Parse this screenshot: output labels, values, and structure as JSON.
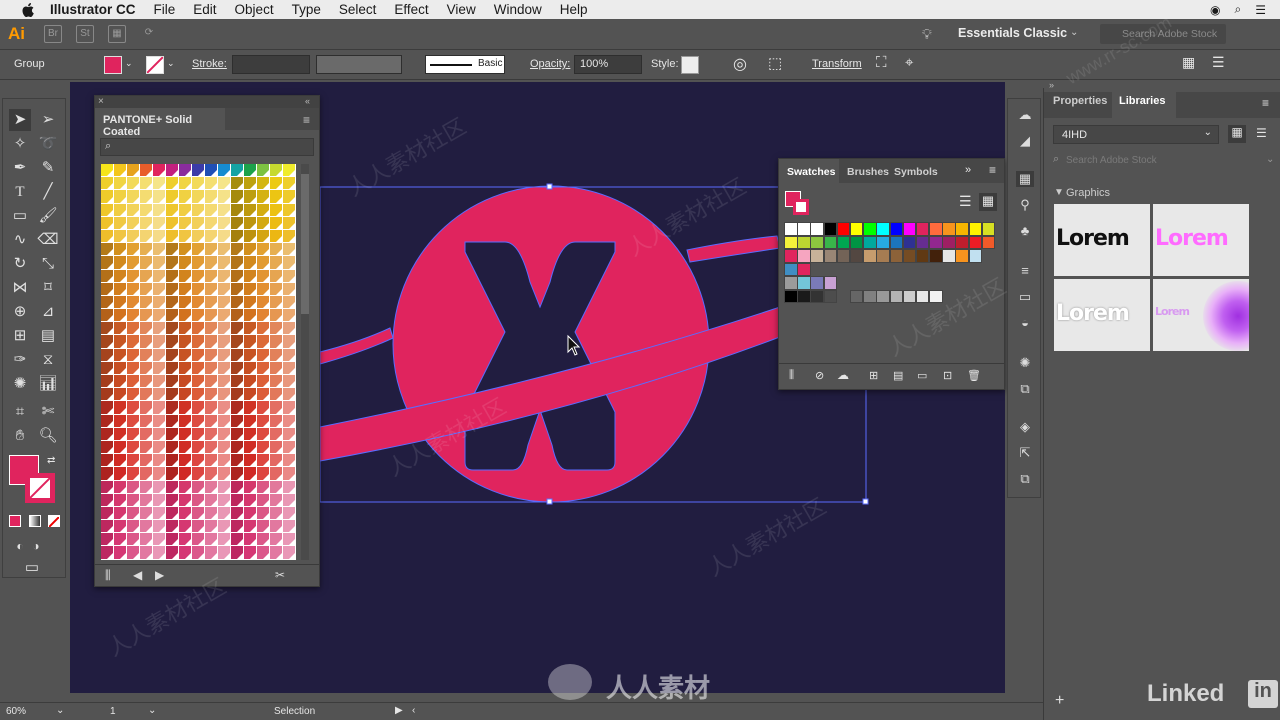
{
  "menubar": {
    "app_name": "Illustrator CC",
    "items": [
      "File",
      "Edit",
      "Object",
      "Type",
      "Select",
      "Effect",
      "View",
      "Window",
      "Help"
    ]
  },
  "appbar": {
    "logo": "Ai",
    "workspace": "Essentials Classic",
    "stock_search_placeholder": "Search Adobe Stock"
  },
  "controlbar": {
    "selection_type": "Group",
    "stroke_label": "Stroke:",
    "brush_basic": "Basic",
    "opacity_label": "Opacity:",
    "opacity_value": "100%",
    "style_label": "Style:",
    "transform_label": "Transform",
    "fill_color": "#e0245e"
  },
  "pantone_panel": {
    "title": "PANTONE+ Solid Coated"
  },
  "swatches_panel": {
    "tabs": [
      "Swatches",
      "Brushes",
      "Symbols"
    ]
  },
  "libraries_panel": {
    "tabs": [
      "Properties",
      "Libraries"
    ],
    "library_name": "4IHD",
    "search_placeholder": "Search Adobe Stock",
    "section": "Graphics",
    "thumbs": [
      "Lorem",
      "Lorem",
      "Lorem",
      "Lorem"
    ]
  },
  "statusbar": {
    "zoom": "60%",
    "artboard": "1",
    "tool": "Selection"
  },
  "watermark": {
    "text": "人人素材社区",
    "brand": "人人素材",
    "site": "www.rr-sc.com",
    "linkedin": "Linked"
  },
  "colors": {
    "canvas": "#211d40",
    "logo_pink": "#e0245e",
    "selection": "#5b6cff"
  }
}
